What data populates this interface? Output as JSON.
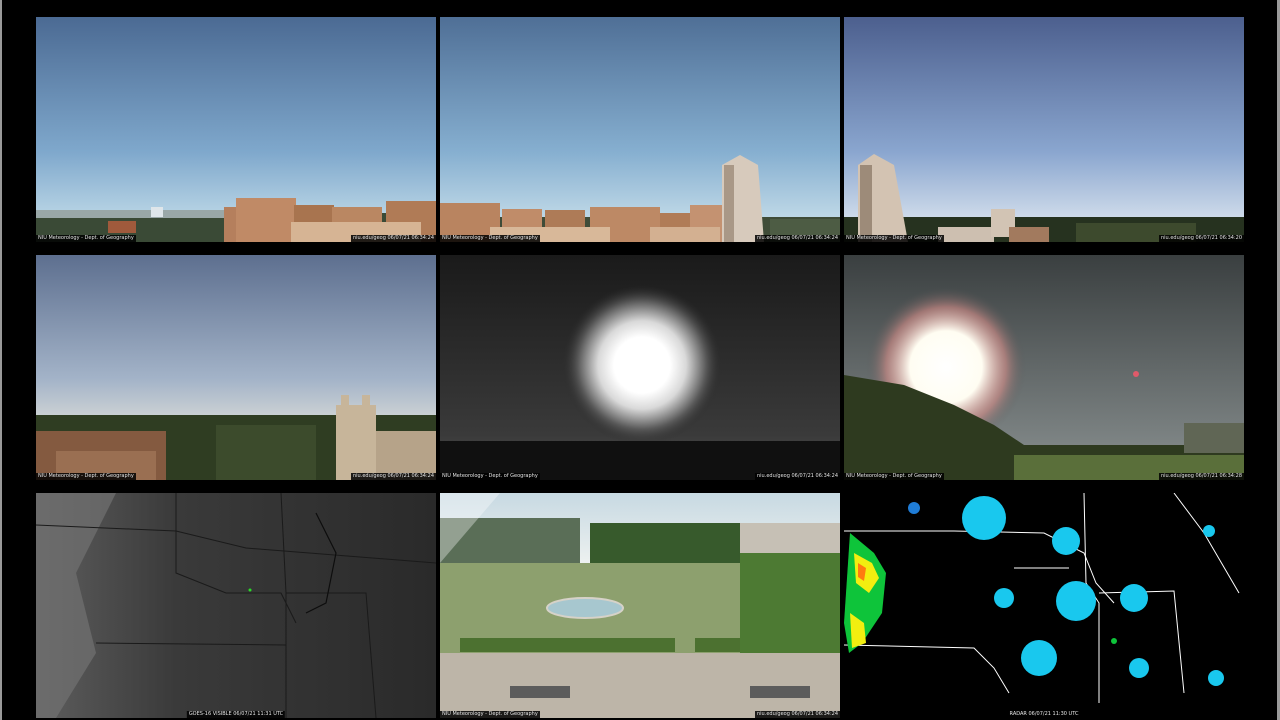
{
  "camera_captions": {
    "north_left": "NIU Meteorology - Dept. of Geography",
    "north_right": "niu.edu/geog  06/07/21  06:34:24",
    "northeast_left": "NIU Meteorology - Dept. of Geography",
    "northeast_right": "niu.edu/geog  06/07/21  06:34:24",
    "east_left": "NIU Meteorology - Dept. of Geography",
    "east_right": "niu.edu/geog  06/07/21  06:34:20",
    "west_left": "NIU Meteorology - Dept. of Geography",
    "west_right": "niu.edu/geog  06/07/21  06:34:24",
    "sun_left": "NIU Meteorology - Dept. of Geography",
    "sun_right": "niu.edu/geog  06/07/21  06:34:24",
    "field_left": "NIU Meteorology - Dept. of Geography",
    "field_right": "niu.edu/geog  06/07/21  06:34:28",
    "satellite_bottom": "GOES-16 VISIBLE  06/07/21  11:31 UTC",
    "plaza_left": "NIU Meteorology - Dept. of Geography",
    "plaza_right": "niu.edu/geog  06/07/21  06:34:24",
    "radar_bottom": "RADAR  06/07/21  11:30 UTC"
  },
  "colors": {
    "background": "#000000",
    "sky_top": "#4d6c93",
    "sky_horizon": "#cfe4f0",
    "radar_echo": "#19c8ee",
    "radar_heavy": "#ffee00"
  }
}
